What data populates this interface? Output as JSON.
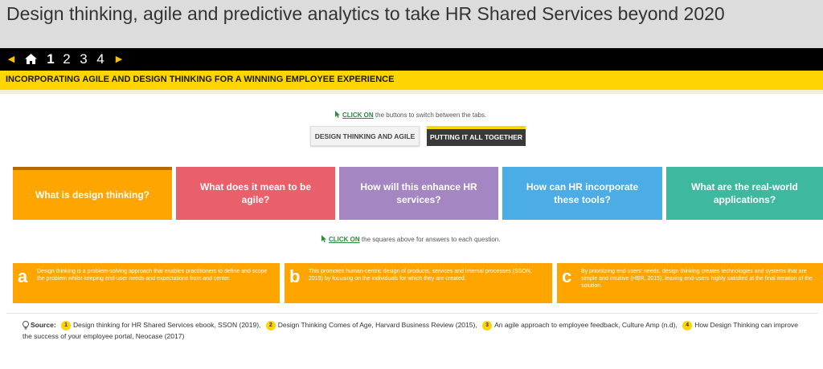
{
  "page": {
    "title": "Design thinking, agile and predictive analytics to take HR Shared Services beyond 2020"
  },
  "nav": {
    "prev_icon": "triangle-left-icon",
    "home_icon": "home-icon",
    "pages": [
      "1",
      "2",
      "3",
      "4"
    ],
    "active_page": "1",
    "next_icon": "triangle-right-icon"
  },
  "section": {
    "label": "INCORPORATING AGILE AND DESIGN THINKING FOR A WINNING EMPLOYEE EXPERIENCE"
  },
  "tabs_hint": {
    "click": "CLICK ON",
    "rest": " the buttons to switch between the tabs."
  },
  "tabs": [
    {
      "label": "DESIGN THINKING AND AGILE",
      "active": false
    },
    {
      "label": "PUTTING IT ALL TOGETHER",
      "active": true
    }
  ],
  "questions": [
    {
      "label": "What is design thinking?",
      "color": "#ffa500",
      "active": true
    },
    {
      "label": "What does it mean to be agile?",
      "color": "#e95f6a",
      "active": false
    },
    {
      "label": "How will this enhance HR services?",
      "color": "#a386c2",
      "active": false
    },
    {
      "label": "How can HR incorporate these tools?",
      "color": "#4cace6",
      "active": false
    },
    {
      "label": "What are the real-world applications?",
      "color": "#3fb8a0",
      "active": false
    }
  ],
  "squares_hint": {
    "click": "CLICK ON",
    "rest": " the squares above for answers to each question."
  },
  "answers": [
    {
      "letter": "a",
      "text": "Design thinking is a problem-solving approach that enables practitioners to define and scope the problem whilst keeping end-user needs and expectations front and center."
    },
    {
      "letter": "b",
      "text": "This promotes human-centric design of products, services and internal processes (SSON, 2019) by focusing on the individuals for which they are created."
    },
    {
      "letter": "c",
      "text": "By prioritizing end users' needs, design thinking creates technologies and systems that are simple and intuitive (HBR, 2015), leaving end-users highly satisfied at the final iteration of the solution."
    }
  ],
  "source": {
    "icon": "lightbulb-icon",
    "label": "Source:",
    "items": [
      {
        "num": "1",
        "text": "Design thinking for HR Shared Services ebook, SSON (2019),"
      },
      {
        "num": "2",
        "text": "Design Thinking Comes of Age, Harvard Business Review (2015),"
      },
      {
        "num": "3",
        "text": "An agile approach to employee feedback, Culture Amp (n.d),"
      },
      {
        "num": "4",
        "text": "How Design Thinking can improve the success of your employee portal, Neocase (2017)"
      }
    ]
  },
  "colors": {
    "accent_yellow": "#ffd500",
    "card_orange": "#ffa500",
    "nav_black": "#000000",
    "title_gray": "#dcdcdc"
  }
}
